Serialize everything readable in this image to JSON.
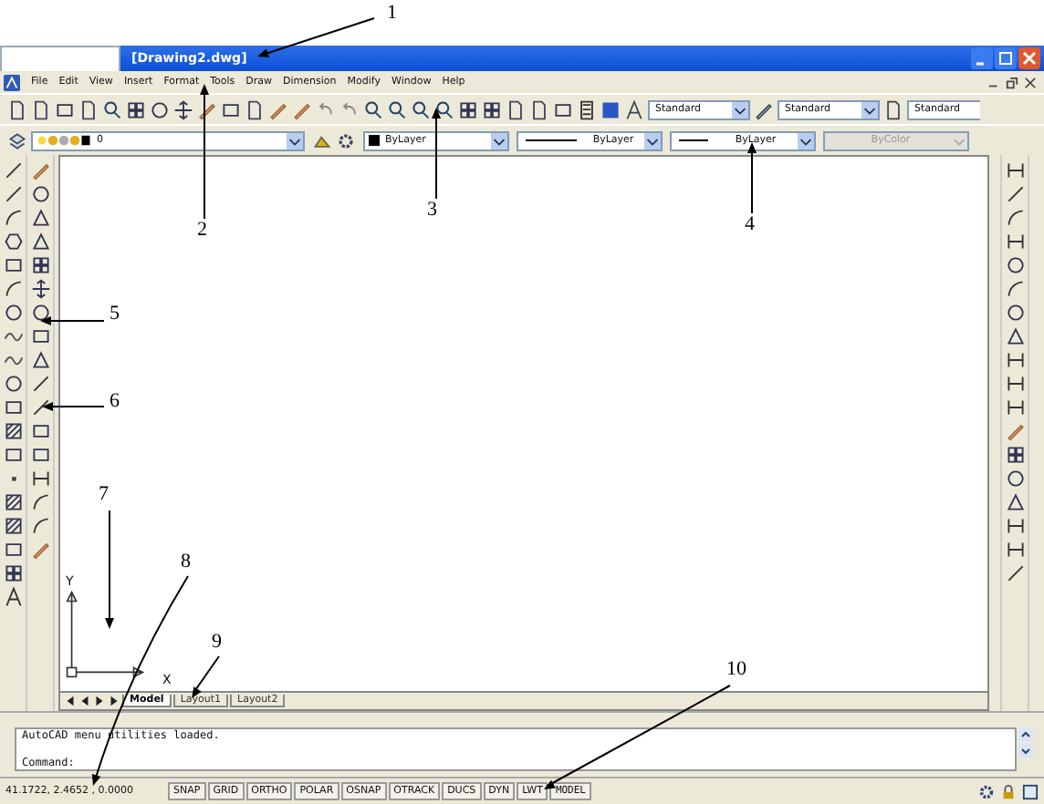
{
  "callouts": [
    {
      "label": "1"
    },
    {
      "label": "2"
    },
    {
      "label": "3"
    },
    {
      "label": "4"
    },
    {
      "label": "5"
    },
    {
      "label": "6"
    },
    {
      "label": "7"
    },
    {
      "label": "8"
    },
    {
      "label": "9"
    },
    {
      "label": "10"
    }
  ],
  "window": {
    "title": "[Drawing2.dwg]"
  },
  "menu": [
    "File",
    "Edit",
    "View",
    "Insert",
    "Format",
    "Tools",
    "Draw",
    "Dimension",
    "Modify",
    "Window",
    "Help"
  ],
  "style_dropdowns": [
    "Standard",
    "Standard",
    "Standard"
  ],
  "layer": {
    "value": "0"
  },
  "properties": [
    {
      "kind": "color",
      "value": "ByLayer",
      "disabled": false
    },
    {
      "kind": "linetype",
      "value": "ByLayer",
      "disabled": false
    },
    {
      "kind": "lineweight",
      "value": "ByLayer",
      "disabled": false
    },
    {
      "kind": "plotstyle",
      "value": "ByColor",
      "disabled": true
    }
  ],
  "ucs": {
    "x_label": "X",
    "y_label": "Y"
  },
  "layout_tabs": [
    {
      "label": "Model",
      "selected": true
    },
    {
      "label": "Layout1",
      "selected": false
    },
    {
      "label": "Layout2",
      "selected": false
    }
  ],
  "command_lines": [
    "AutoCAD menu utilities loaded.",
    "Command:"
  ],
  "status_bar": {
    "coordinates": "41.1722, 2.4652 , 0.0000",
    "toggles": [
      "SNAP",
      "GRID",
      "ORTHO",
      "POLAR",
      "OSNAP",
      "OTRACK",
      "DUCS",
      "DYN",
      "LWT"
    ],
    "space": "MODEL"
  }
}
